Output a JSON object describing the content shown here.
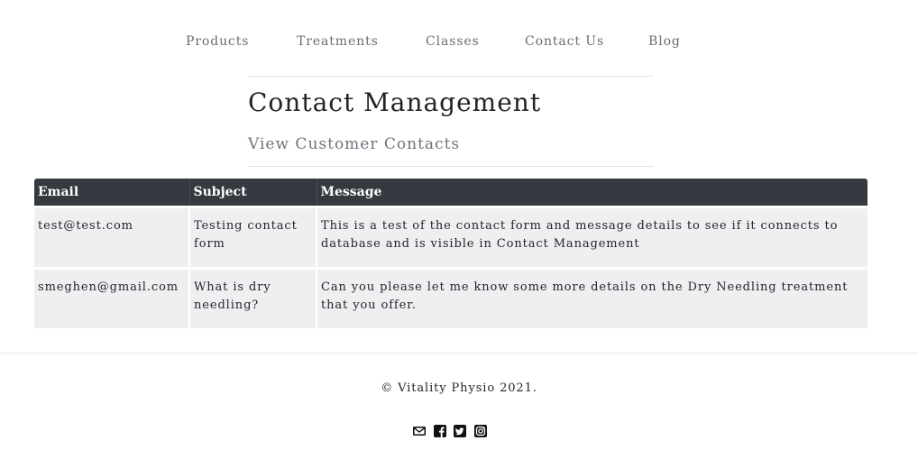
{
  "nav": {
    "items": [
      {
        "label": "Products"
      },
      {
        "label": "Treatments"
      },
      {
        "label": "Classes"
      },
      {
        "label": "Contact Us"
      },
      {
        "label": "Blog"
      }
    ]
  },
  "header": {
    "title": "Contact Management",
    "subtitle": "View Customer Contacts"
  },
  "table": {
    "columns": [
      "Email",
      "Subject",
      "Message"
    ],
    "rows": [
      {
        "email": "test@test.com",
        "subject": "Testing contact form",
        "message": "This is a test of the contact form and message details to see if it connects to database and is visible in Contact Management"
      },
      {
        "email": "smeghen@gmail.com",
        "subject": "What is dry needling?",
        "message": "Can you please let me know some more details on the Dry Needling treatment that you offer."
      }
    ]
  },
  "footer": {
    "copyright": "© Vitality Physio 2021.",
    "social_icons": [
      "envelope-icon",
      "facebook-icon",
      "twitter-icon",
      "instagram-icon"
    ]
  },
  "colors": {
    "table_header_bg": "#343a40",
    "table_row_bg": "#efeff1",
    "nav_text": "#6c6c6c"
  }
}
